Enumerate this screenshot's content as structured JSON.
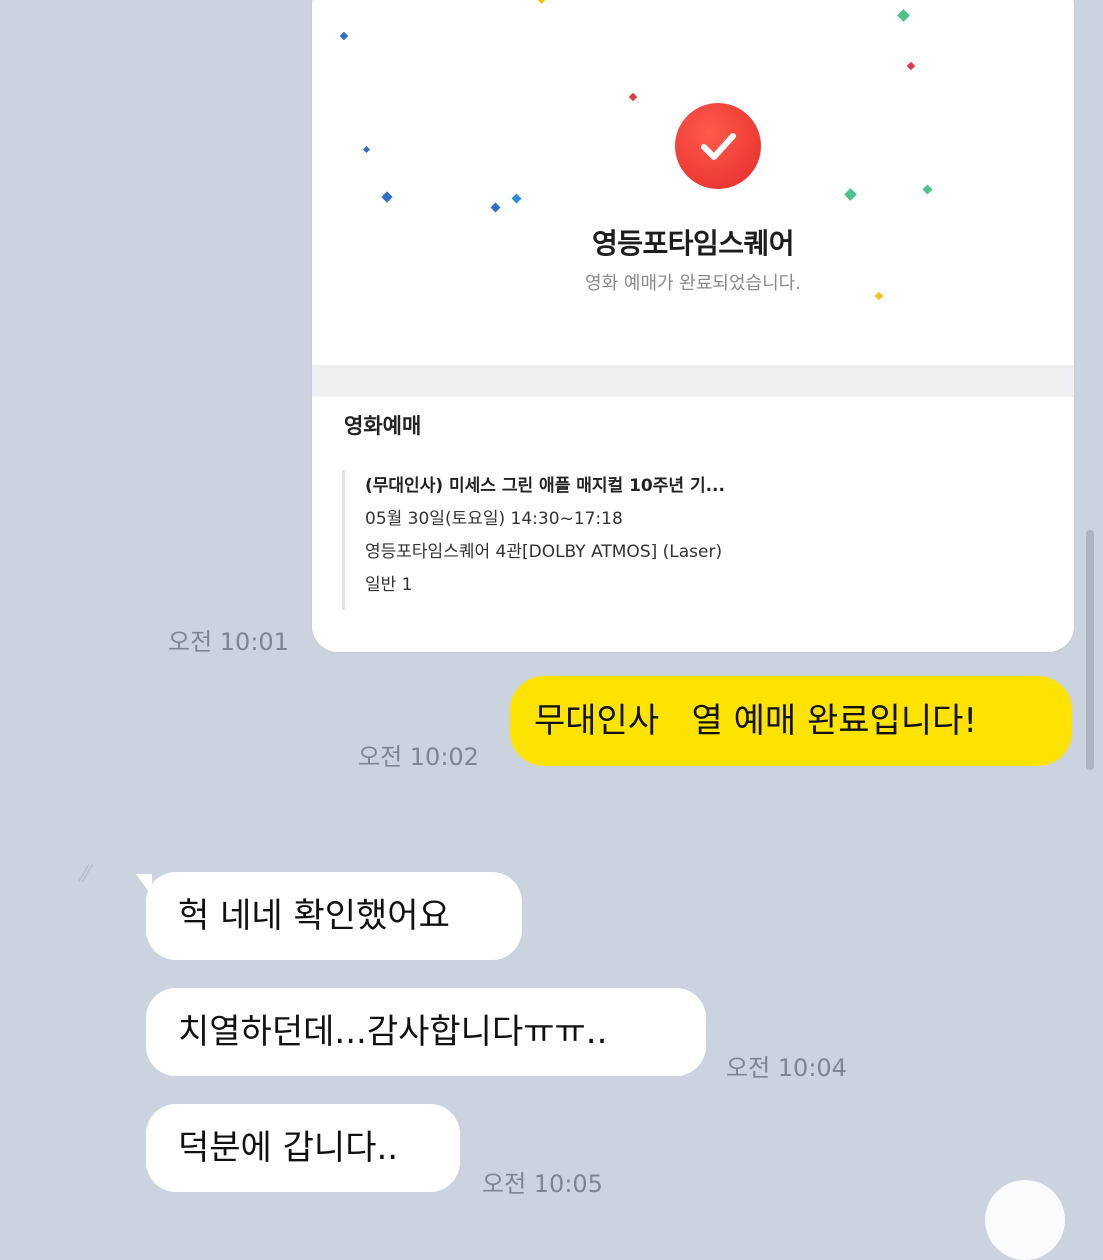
{
  "receipt": {
    "theater_name": "영등포타임스퀘어",
    "complete_message": "영화 예매가 완료되었습니다.",
    "section_title": "영화예매",
    "details": [
      "(무대인사) 미세스 그린 애플 매지컬 10주년 기...",
      "05월 30일(토요일) 14:30~17:18",
      "영등포타임스퀘어 4관[DOLBY ATMOS] (Laser)",
      "일반 1"
    ],
    "timestamp": "오전 10:01",
    "accent_color": "#e42b2b"
  },
  "messages": [
    {
      "side": "mine",
      "text": "무대인사   열 예매 완료입니다!",
      "time": "오전 10:02"
    },
    {
      "side": "other",
      "text": "헉 네네 확인했어요",
      "time": ""
    },
    {
      "side": "other",
      "text": "치열하던데...감사합니다ㅠㅠ..",
      "time": "오전 10:04"
    },
    {
      "side": "other",
      "text": "덕분에 갑니다..",
      "time": "오전 10:05"
    }
  ],
  "colors": {
    "background": "#cbd3df",
    "my_bubble": "#fde400",
    "other_bubble": "#ffffff"
  }
}
